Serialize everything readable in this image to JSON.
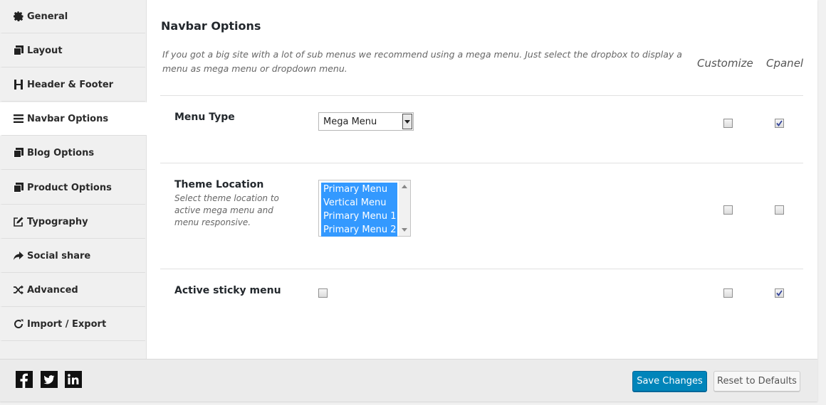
{
  "sidebar": {
    "items": [
      {
        "label": "General",
        "icon": "gear-icon"
      },
      {
        "label": "Layout",
        "icon": "copy-icon"
      },
      {
        "label": "Header & Footer",
        "icon": "header-icon"
      },
      {
        "label": "Navbar Options",
        "icon": "bars-icon",
        "active": true
      },
      {
        "label": "Blog Options",
        "icon": "copy-icon"
      },
      {
        "label": "Product Options",
        "icon": "copy-icon"
      },
      {
        "label": "Typography",
        "icon": "edit-icon"
      },
      {
        "label": "Social share",
        "icon": "share-icon"
      },
      {
        "label": "Advanced",
        "icon": "random-icon"
      },
      {
        "label": "Import / Export",
        "icon": "refresh-icon"
      }
    ]
  },
  "main": {
    "title": "Navbar Options",
    "description": "If you got a big site with a lot of sub menus we recommend using a mega menu. Just select the dropbox to display a menu as mega menu or dropdown menu.",
    "columns": {
      "customize": "Customize",
      "cpanel": "Cpanel"
    },
    "options": {
      "menu_type": {
        "label": "Menu Type",
        "selected": "Mega Menu",
        "customize_checked": false,
        "cpanel_checked": true
      },
      "theme_location": {
        "label": "Theme Location",
        "subtitle": "Select theme location to active mega menu and menu responsive.",
        "selected_options": [
          "Primary Menu",
          "Vertical Menu",
          "Primary Menu 1",
          "Primary Menu 2"
        ],
        "customize_checked": false,
        "cpanel_checked": false
      },
      "sticky_menu": {
        "label": "Active sticky menu",
        "checked": false,
        "customize_checked": false,
        "cpanel_checked": true
      }
    }
  },
  "footer": {
    "social": [
      "facebook-icon",
      "twitter-icon",
      "linkedin-icon"
    ],
    "save_label": "Save Changes",
    "reset_label": "Reset to Defaults"
  },
  "colors": {
    "primary_button": "#0085ba",
    "selected_option": "#3399ff",
    "sidebar_bg": "#f0f0f0"
  }
}
